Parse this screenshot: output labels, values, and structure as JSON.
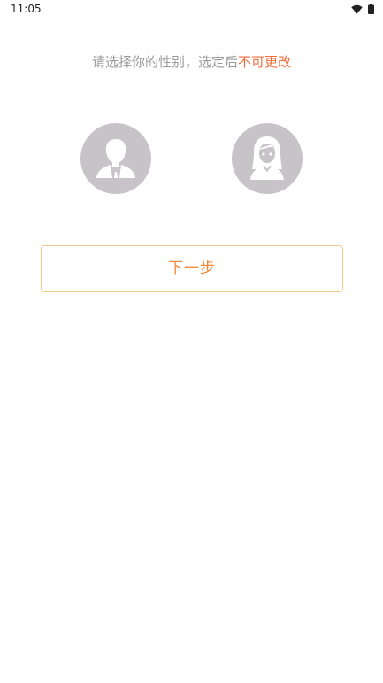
{
  "status_bar": {
    "time": "11:05",
    "icons": [
      "wifi-icon",
      "battery-icon"
    ]
  },
  "prompt": {
    "text": "请选择你的性别，选定后",
    "warning": "不可更改"
  },
  "gender_options": [
    {
      "name": "male",
      "icon": "male-avatar-icon"
    },
    {
      "name": "female",
      "icon": "female-avatar-icon"
    }
  ],
  "next_button": {
    "label": "下一步"
  },
  "colors": {
    "warning": "#ef6f3c",
    "button_text": "#ef8a3c",
    "button_border": "#f3c98e",
    "avatar_bg": "#c7c3c8",
    "prompt_text": "#9a9a9a"
  }
}
